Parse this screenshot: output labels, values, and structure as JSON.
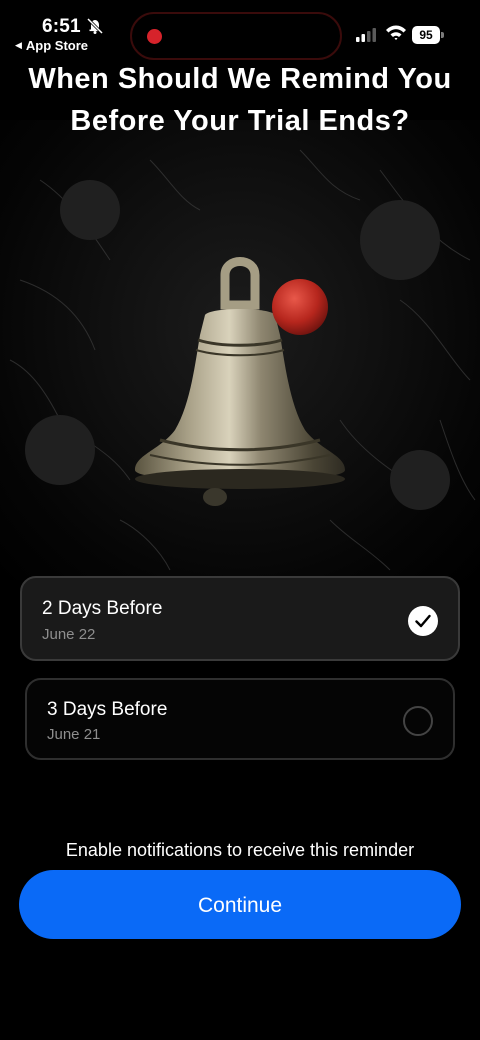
{
  "status_bar": {
    "time": "6:51",
    "back_app": "App Store",
    "battery": "95",
    "icons": [
      "bell-slash-icon",
      "record-dot-icon",
      "cellular-signal-icon",
      "wifi-icon",
      "battery-icon"
    ],
    "record_color": "#d6232b"
  },
  "title": "When Should We Remind You\nBefore Your Trial Ends?",
  "hero": {
    "icon": "bell-illustration"
  },
  "options": [
    {
      "title": "2 Days Before",
      "subtitle": "June 22",
      "selected": true
    },
    {
      "title": "3 Days Before",
      "subtitle": "June 21",
      "selected": false
    }
  ],
  "notification_hint": "Enable notifications to receive this reminder",
  "continue_label": "Continue",
  "colors": {
    "accent": "#0a6af7",
    "background": "#000000",
    "card_selected": "#1a1a1a"
  }
}
